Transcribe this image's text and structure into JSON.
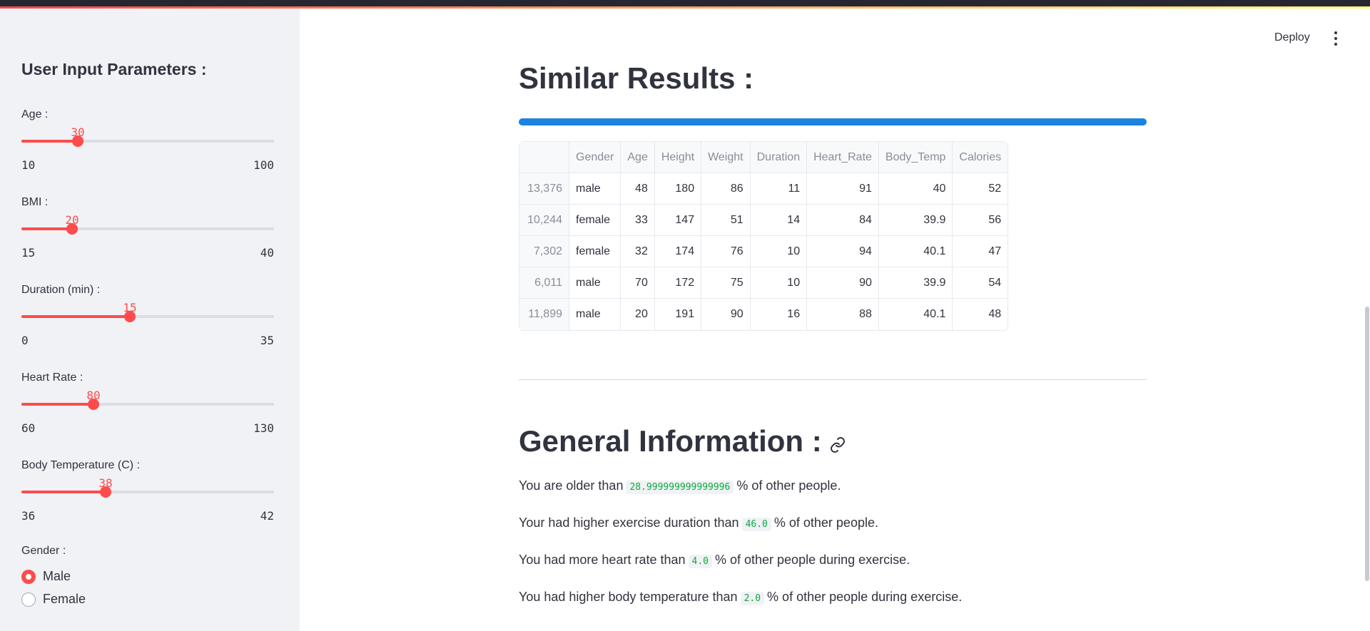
{
  "sidebar": {
    "title": "User Input Parameters :",
    "params": [
      {
        "label": "Age :",
        "value": "30",
        "min": "10",
        "max": "100",
        "fraction": 0.2222
      },
      {
        "label": "BMI :",
        "value": "20",
        "min": "15",
        "max": "40",
        "fraction": 0.2
      },
      {
        "label": "Duration (min) :",
        "value": "15",
        "min": "0",
        "max": "35",
        "fraction": 0.4286
      },
      {
        "label": "Heart Rate :",
        "value": "80",
        "min": "60",
        "max": "130",
        "fraction": 0.2857
      },
      {
        "label": "Body Temperature (C) :",
        "value": "38",
        "min": "36",
        "max": "42",
        "fraction": 0.3333
      }
    ],
    "gender": {
      "label": "Gender :",
      "options": [
        "Male",
        "Female"
      ],
      "selected": "Male"
    }
  },
  "header": {
    "deploy_label": "Deploy",
    "menu_icon": "kebab-menu-icon"
  },
  "similar": {
    "title": "Similar Results :",
    "progress": 1.0,
    "columns": [
      "",
      "Gender",
      "Age",
      "Height",
      "Weight",
      "Duration",
      "Heart_Rate",
      "Body_Temp",
      "Calories"
    ],
    "rows": [
      [
        "13,376",
        "male",
        "48",
        "180",
        "86",
        "11",
        "91",
        "40",
        "52"
      ],
      [
        "10,244",
        "female",
        "33",
        "147",
        "51",
        "14",
        "84",
        "39.9",
        "56"
      ],
      [
        "7,302",
        "female",
        "32",
        "174",
        "76",
        "10",
        "94",
        "40.1",
        "47"
      ],
      [
        "6,011",
        "male",
        "70",
        "172",
        "75",
        "10",
        "90",
        "39.9",
        "54"
      ],
      [
        "11,899",
        "male",
        "20",
        "191",
        "90",
        "16",
        "88",
        "40.1",
        "48"
      ]
    ]
  },
  "general": {
    "title": "General Information :",
    "link_icon": "link-icon",
    "lines": [
      {
        "before": "You are older than",
        "value": "28.999999999999996",
        "after": "% of other people."
      },
      {
        "before": "Your had higher exercise duration than",
        "value": "46.0",
        "after": "% of other people."
      },
      {
        "before": "You had more heart rate than",
        "value": "4.0",
        "after": "% of other people during exercise."
      },
      {
        "before": "You had higher body temperature than",
        "value": "2.0",
        "after": "% of other people during exercise."
      }
    ]
  },
  "colors": {
    "accent": "#ff4b4b",
    "progress": "#1c83e1",
    "code_text": "#09ab3b",
    "sidebar_bg": "#f0f2f6"
  }
}
